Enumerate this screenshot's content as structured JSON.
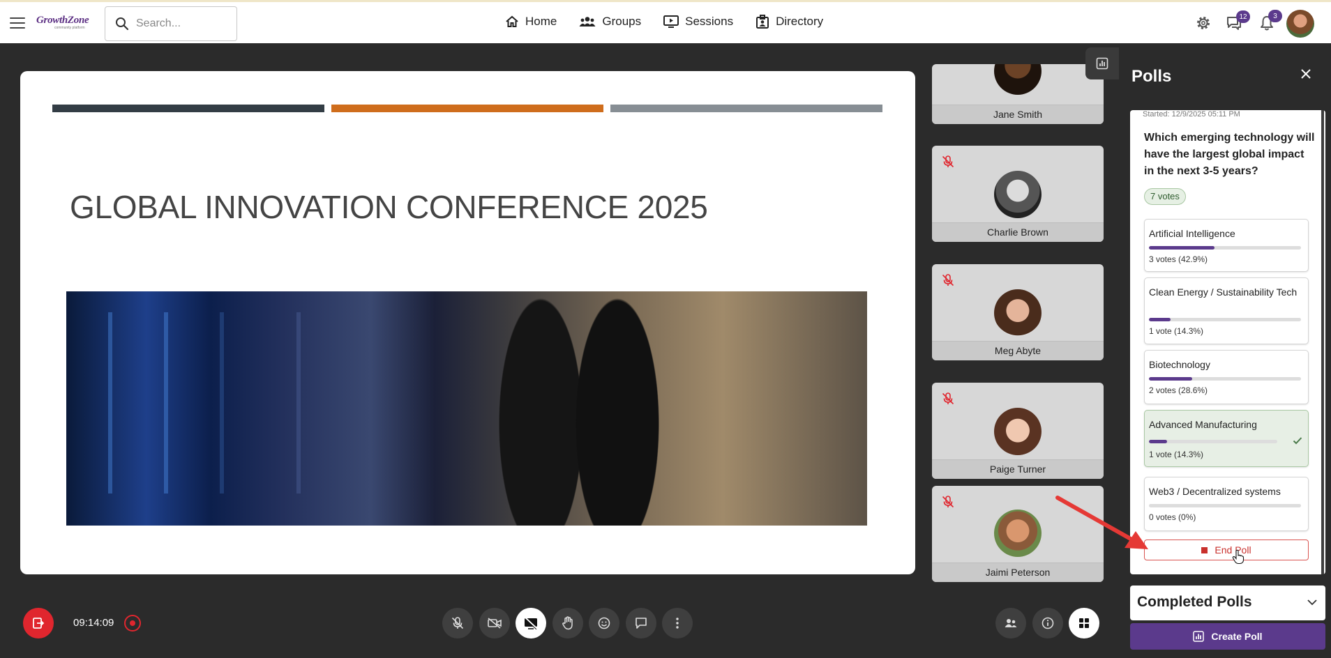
{
  "topbar": {
    "logo_main": "GrowthZone",
    "logo_sub": "community platform",
    "search_placeholder": "Search...",
    "nav": [
      {
        "label": "Home",
        "icon": "home-icon"
      },
      {
        "label": "Groups",
        "icon": "groups-icon"
      },
      {
        "label": "Sessions",
        "icon": "sessions-icon"
      },
      {
        "label": "Directory",
        "icon": "directory-icon"
      }
    ],
    "messages_count": "12",
    "notifications_count": "3"
  },
  "slide": {
    "title": "GLOBAL INNOVATION CONFERENCE 2025",
    "bar_colors": [
      "#333d45",
      "#cf6d1c",
      "#878e94"
    ]
  },
  "participants": [
    {
      "name": "Jane Smith",
      "muted": false
    },
    {
      "name": "Charlie Brown",
      "muted": true
    },
    {
      "name": "Meg Abyte",
      "muted": true
    },
    {
      "name": "Paige Turner",
      "muted": true
    },
    {
      "name": "Jaimi Peterson",
      "muted": true
    }
  ],
  "polls": {
    "title": "Polls",
    "started": "Started: 12/9/2025 05:11 PM",
    "question": "Which emerging technology will have the largest global impact in the next 3-5 years?",
    "total_votes": "7 votes",
    "options": [
      {
        "label": "Artificial Intelligence",
        "count": "3 votes (42.9%)",
        "percent": 42.9,
        "selected": false
      },
      {
        "label": "Clean Energy / Sustainability Tech",
        "count": "1 vote (14.3%)",
        "percent": 14.3,
        "selected": false
      },
      {
        "label": "Biotechnology",
        "count": "2 votes (28.6%)",
        "percent": 28.6,
        "selected": false
      },
      {
        "label": "Advanced Manufacturing",
        "count": "1 vote (14.3%)",
        "percent": 14.3,
        "selected": true
      },
      {
        "label": "Web3 / Decentralized systems",
        "count": "0 votes (0%)",
        "percent": 0,
        "selected": false
      }
    ],
    "end_poll_label": "End Poll",
    "completed_label": "Completed Polls",
    "create_label": "Create Poll"
  },
  "controls": {
    "timer": "09:14:09"
  },
  "colors": {
    "brand_purple": "#5b3a8c",
    "danger_red": "#e0262e"
  }
}
